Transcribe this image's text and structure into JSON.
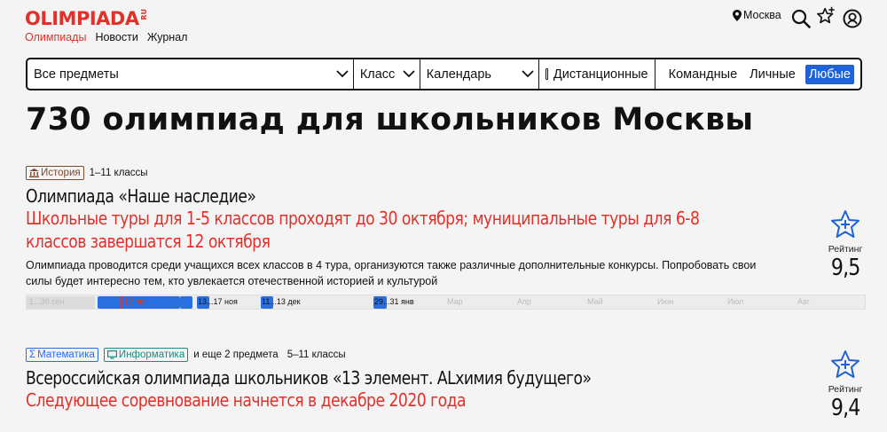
{
  "header": {
    "logo_text": "OLIMPIADA",
    "logo_suffix": "RU",
    "nav": [
      {
        "label": "Олимпиады",
        "active": true
      },
      {
        "label": "Новости",
        "active": false
      },
      {
        "label": "Журнал",
        "active": false
      }
    ],
    "city": "Москва",
    "icons": [
      "map-pin-icon",
      "search-icon",
      "star-badge-icon",
      "profile-icon"
    ]
  },
  "filters": {
    "subject": "Все предметы",
    "grade": "Класс",
    "calendar": "Календарь",
    "remote": "Дистанционные",
    "participation": [
      "Командные",
      "Личные",
      "Любые"
    ],
    "participation_selected": "Любые"
  },
  "page_title": "730 олимпиад для школьников Москвы",
  "olympiads": [
    {
      "tags": [
        {
          "label": "История",
          "icon": "museum-icon"
        }
      ],
      "grades": "1–11 классы",
      "title": "Олимпиада «Наше наследие»",
      "subtitle": "Школьные туры для 1-5 классов проходят до 30 октября; муниципальные туры для 6-8 классов завершатся 12 октября",
      "description": "Олимпиада проводится среди учащихся всех классов в 4 тура, организуются также различные дополнительные конкурсы. Попробовать свои силы будет интересно тем, кто увлекается отечественной историей и культурой",
      "rating_label": "Рейтинг",
      "rating": "9,5",
      "timeline": {
        "past_label": "1...30 сен",
        "events": [
          "12 окт",
          "13...17 ноя",
          "11...13 дек",
          "29...31 янв"
        ],
        "months": [
          "Мар",
          "Апр",
          "Май",
          "Июн",
          "Июл",
          "Авг"
        ]
      }
    },
    {
      "tags": [
        {
          "label": "Математика",
          "icon": "sigma-icon"
        },
        {
          "label": "Информатика",
          "icon": "monitor-icon"
        }
      ],
      "more_subjects": "и еще 2 предмета",
      "grades": "5–11 классы",
      "title": "Всероссийская олимпиада школьников «13 элемент. ALхимия будущего»",
      "subtitle": "Следующее соревнование начнется в декабре 2020 года",
      "rating_label": "Рейтинг",
      "rating": "9,4"
    }
  ],
  "colors": {
    "accent": "#e33029",
    "blue": "#1f63d6",
    "background": "#f4f4f4"
  }
}
